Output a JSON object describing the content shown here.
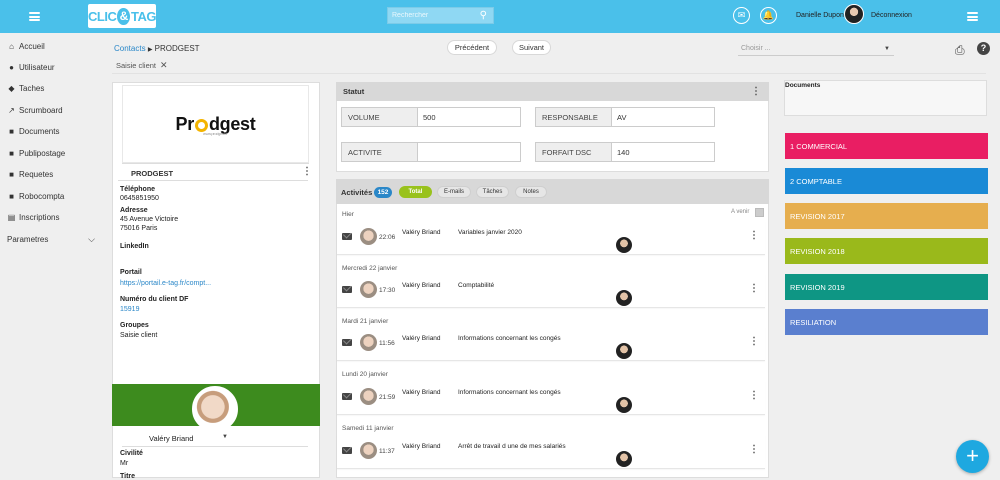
{
  "header": {
    "logo_left": "CLIC",
    "logo_amp": "&",
    "logo_right": "TAG",
    "search_placeholder": "Rechercher",
    "user_name": "Danielle Dupond",
    "logout": "Déconnexion",
    "accent": "#4ac0ea"
  },
  "sidebar": {
    "items": [
      {
        "label": "Accueil",
        "icon": "home-icon"
      },
      {
        "label": "Utilisateur",
        "icon": "user-icon"
      },
      {
        "label": "Taches",
        "icon": "tag-icon"
      },
      {
        "label": "Scrumboard",
        "icon": "chart-icon"
      },
      {
        "label": "Documents",
        "icon": "folder-icon"
      },
      {
        "label": "Publipostage",
        "icon": "folder-icon"
      },
      {
        "label": "Requetes",
        "icon": "folder-icon"
      },
      {
        "label": "Robocompta",
        "icon": "folder-icon"
      },
      {
        "label": "Inscriptions",
        "icon": "book-icon"
      }
    ],
    "settings": "Parametres"
  },
  "contactbar": {
    "crumb_link": "Contacts",
    "crumb_current": "PRODGEST",
    "prev": "Précédent",
    "next": "Suivant",
    "choose_placeholder": "Choisir ...",
    "filter": "Saisie client"
  },
  "card": {
    "logo_p": "Pr",
    "logo_rest": "dgest",
    "logo_sub": "www.prodgest.fr",
    "company": "PRODGEST",
    "phone_label": "Téléphone",
    "phone": "0645851950",
    "address_label": "Adresse",
    "address1": "45 Avenue Victoire",
    "address2": "75016 Paris",
    "linkedin_label": "LinkedIn",
    "portal_label": "Portail",
    "portal": "https://portail.e-tag.fr/compt...",
    "client_label": "Numéro du client DF",
    "client": "15919",
    "groups_label": "Groupes",
    "groups": "Saisie client",
    "user": "Valéry Briand",
    "civilite_label": "Civilité",
    "civilite": "Mr",
    "titre_label": "Titre"
  },
  "statut": {
    "title": "Statut",
    "fields": [
      {
        "key": "VOLUME",
        "value": "500"
      },
      {
        "key": "RESPONSABLE",
        "value": "AV"
      },
      {
        "key": "ACTIVITE",
        "value": ""
      },
      {
        "key": "FORFAIT DSC",
        "value": "140"
      }
    ]
  },
  "activities": {
    "title": "Activités",
    "count": "152",
    "tabs": [
      "Total",
      "E-mails",
      "Tâches",
      "Notes"
    ],
    "avenir": "A venir",
    "days": [
      {
        "label": "Hier",
        "time": "22:06",
        "who": "Valéry Briand",
        "subject": "Variables janvier 2020"
      },
      {
        "label": "Mercredi 22 janvier",
        "time": "17:30",
        "who": "Valéry Briand",
        "subject": "Comptabilité"
      },
      {
        "label": "Mardi 21 janvier",
        "time": "11:56",
        "who": "Valéry Briand",
        "subject": "Informations concernant les congés"
      },
      {
        "label": "Lundi 20 janvier",
        "time": "21:59",
        "who": "Valéry Briand",
        "subject": "Informations concernant les congés"
      },
      {
        "label": "Samedi 11 janvier",
        "time": "11:37",
        "who": "Valéry Briand",
        "subject": "Arrêt de travail d une de mes salariés"
      }
    ]
  },
  "documents": {
    "title": "Documents",
    "categories": [
      {
        "label": "1 COMMERCIAL",
        "color": "#e91e63"
      },
      {
        "label": "2 COMPTABLE",
        "color": "#1a8ad6"
      },
      {
        "label": "REVISION 2017",
        "color": "#e6ae4e"
      },
      {
        "label": "REVISION 2018",
        "color": "#9ab91b"
      },
      {
        "label": "REVISION 2019",
        "color": "#0e9684"
      },
      {
        "label": "RESILIATION",
        "color": "#5a7fcf"
      }
    ]
  },
  "fab": "+"
}
